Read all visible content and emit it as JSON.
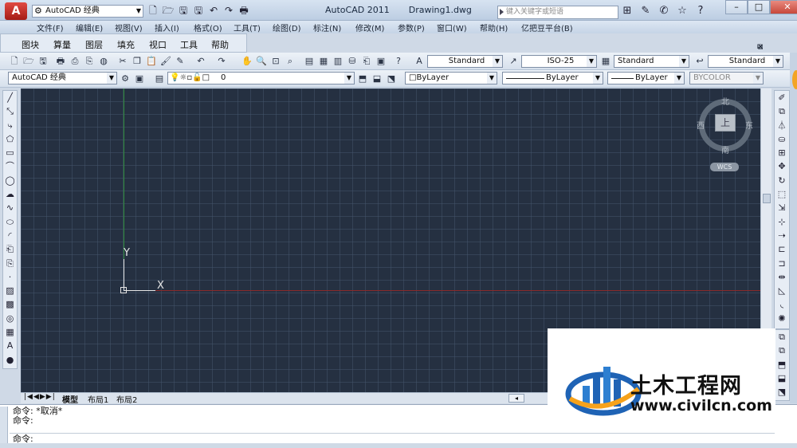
{
  "titlebar": {
    "app_icon": "A",
    "workspace": "AutoCAD 经典",
    "app_name": "AutoCAD 2011",
    "document": "Drawing1.dwg",
    "search_placeholder": "键入关键字或短语",
    "min": "–",
    "max": "□",
    "close": "✕"
  },
  "menubar": {
    "items": [
      "文件(F)",
      "编辑(E)",
      "视图(V)",
      "插入(I)",
      "格式(O)",
      "工具(T)",
      "绘图(D)",
      "标注(N)",
      "修改(M)",
      "参数(P)",
      "窗口(W)",
      "帮助(H)",
      "亿把豆平台(B)"
    ]
  },
  "menubar2": {
    "items": [
      "图块",
      "算量",
      "图层",
      "填充",
      "视口",
      "工具",
      "帮助"
    ]
  },
  "styles": {
    "text_style": "Standard",
    "dim_style": "ISO-25",
    "table_style": "Standard",
    "mleader_style": "Standard"
  },
  "props": {
    "workspace": "AutoCAD 经典",
    "layer": "0",
    "color": "ByLayer",
    "linetype": "ByLayer",
    "lineweight": "ByLayer",
    "plotstyle": "BYCOLOR"
  },
  "viewcube": {
    "north": "北",
    "south": "南",
    "east": "东",
    "west": "西",
    "top": "上",
    "wcs": "WCS"
  },
  "ucs": {
    "x": "X",
    "y": "Y"
  },
  "tabs": {
    "model": "模型",
    "layout1": "布局1",
    "layout2": "布局2"
  },
  "command": {
    "line1": "命令: *取消*",
    "line2": "命令:",
    "prompt": "命令:"
  },
  "watermark": {
    "name": "土木工程网",
    "url": "www.civilcn.com"
  }
}
